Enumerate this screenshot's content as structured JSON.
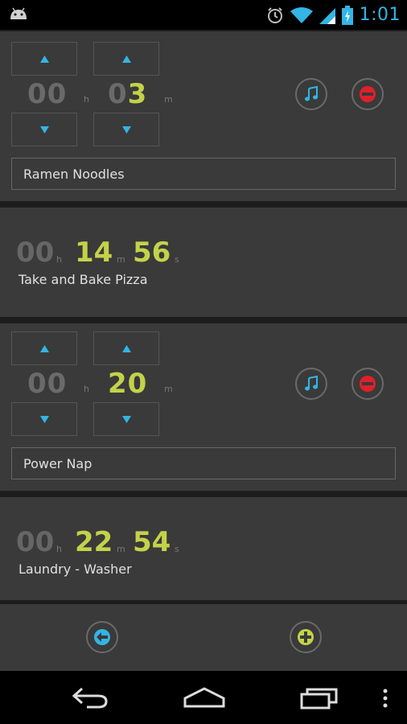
{
  "status": {
    "time": "1:01"
  },
  "editing_timers": [
    {
      "hours": "00",
      "minutes_dim": "0",
      "minutes_lit": "3",
      "hour_unit": "h",
      "minute_unit": "m",
      "name": "Ramen Noodles"
    },
    {
      "hours": "00",
      "minutes_dim": "",
      "minutes_lit": "20",
      "hour_unit": "h",
      "minute_unit": "m",
      "name": "Power Nap"
    }
  ],
  "running_timers": [
    {
      "hours": "00",
      "minutes": "14",
      "seconds": "56",
      "hour_unit": "h",
      "minute_unit": "m",
      "second_unit": "s",
      "name": "Take and Bake Pizza"
    },
    {
      "hours": "00",
      "minutes": "22",
      "seconds": "54",
      "hour_unit": "h",
      "minute_unit": "m",
      "second_unit": "s",
      "name": "Laundry - Washer"
    }
  ],
  "icons": {
    "up_arrow": "up-arrow-icon",
    "down_arrow": "down-arrow-icon",
    "music": "music-note-icon",
    "remove": "minus-icon",
    "back": "back-arrow-icon",
    "add": "plus-icon"
  },
  "colors": {
    "accent": "#c4d24a",
    "blue": "#33b5e5",
    "remove": "#e0202a"
  }
}
